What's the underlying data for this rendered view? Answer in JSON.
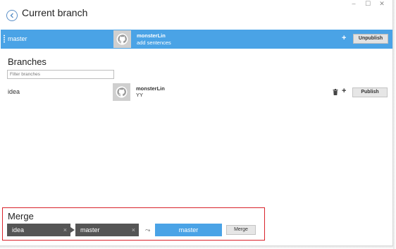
{
  "header": {
    "title": "Current branch",
    "back_icon": "back-arrow-icon"
  },
  "window_controls": [
    "minimize-icon",
    "maximize-icon",
    "close-icon"
  ],
  "current_branch": {
    "name": "master",
    "commit_author": "monsterLin",
    "commit_message": "add sentences",
    "add_label": "+",
    "unpublish_label": "Unpublish",
    "bar_color": "#4aa3e6"
  },
  "branches": {
    "heading": "Branches",
    "filter_placeholder": "Filter branches",
    "items": [
      {
        "name": "idea",
        "commit_author": "monsterLin",
        "commit_message": "YY",
        "add_label": "+",
        "publish_label": "Publish"
      }
    ]
  },
  "merge": {
    "heading": "Merge",
    "source_branch": "idea",
    "target_branch": "master",
    "remove_label": "×",
    "merge_symbol": "⤳",
    "result_branch": "master",
    "merge_label": "Merge",
    "highlight_color": "#d9232b"
  }
}
